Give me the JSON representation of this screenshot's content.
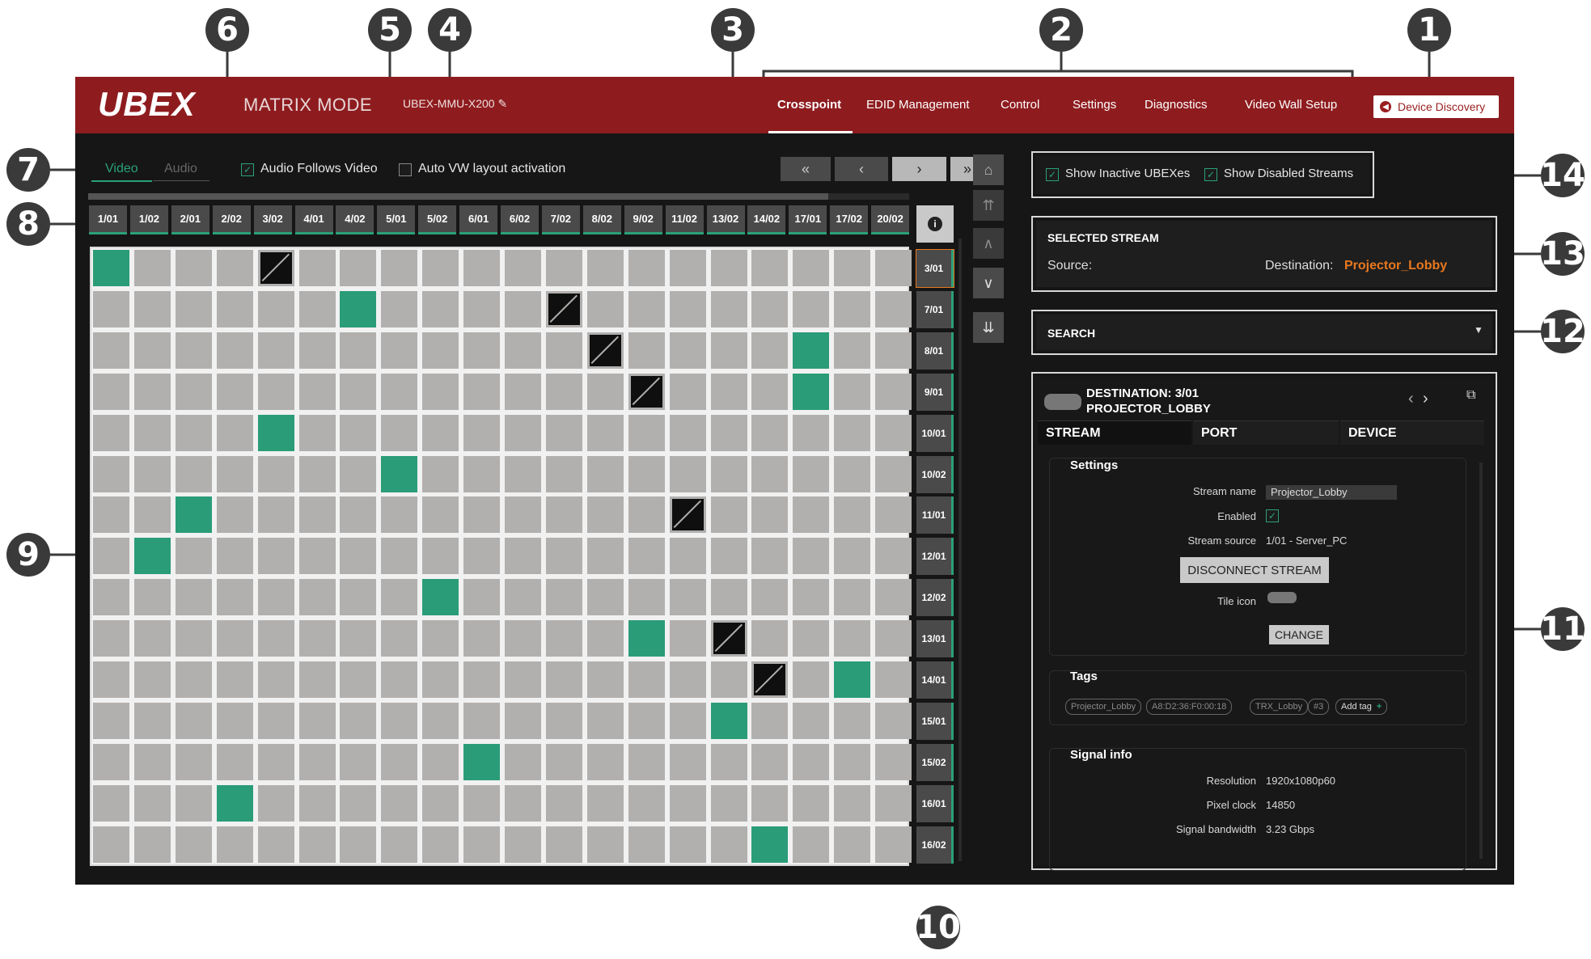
{
  "callouts": [
    "1",
    "2",
    "3",
    "4",
    "5",
    "6",
    "7",
    "8",
    "9",
    "10",
    "11",
    "12",
    "13",
    "14"
  ],
  "header": {
    "logo": "UBEX",
    "mode": "MATRIX MODE",
    "device_name": "UBEX-MMU-X200",
    "nav": [
      "Crosspoint",
      "EDID Management",
      "Control",
      "Settings",
      "Diagnostics",
      "Video Wall Setup"
    ],
    "device_discovery": "Device Discovery"
  },
  "toolbar": {
    "tab_video": "Video",
    "tab_audio": "Audio",
    "audio_follows_video": "Audio Follows Video",
    "auto_vw": "Auto VW layout activation",
    "first": "«",
    "prev": "‹",
    "next": "›",
    "last": "»"
  },
  "matrix": {
    "columns": [
      "1/01",
      "1/02",
      "2/01",
      "2/02",
      "3/02",
      "4/01",
      "4/02",
      "5/01",
      "5/02",
      "6/01",
      "6/02",
      "7/02",
      "8/02",
      "9/02",
      "11/02",
      "13/02",
      "14/02",
      "17/01",
      "17/02",
      "20/02"
    ],
    "rows": [
      "3/01",
      "7/01",
      "8/01",
      "9/01",
      "10/01",
      "10/02",
      "11/01",
      "12/01",
      "12/02",
      "13/01",
      "14/01",
      "15/01",
      "15/02",
      "16/01",
      "16/02"
    ],
    "connected": [
      [
        0,
        0
      ],
      [
        1,
        6
      ],
      [
        2,
        17
      ],
      [
        3,
        17
      ],
      [
        4,
        4
      ],
      [
        5,
        7
      ],
      [
        6,
        2
      ],
      [
        7,
        1
      ],
      [
        8,
        8
      ],
      [
        9,
        13
      ],
      [
        10,
        18
      ],
      [
        11,
        15
      ],
      [
        12,
        9
      ],
      [
        13,
        3
      ],
      [
        14,
        16
      ]
    ],
    "disabled": [
      [
        0,
        4
      ],
      [
        1,
        11
      ],
      [
        2,
        12
      ],
      [
        3,
        13
      ],
      [
        6,
        14
      ],
      [
        9,
        15
      ],
      [
        10,
        16
      ]
    ]
  },
  "options": {
    "show_inactive": "Show Inactive UBEXes",
    "show_disabled": "Show Disabled Streams"
  },
  "selected_stream": {
    "title": "SELECTED STREAM",
    "source_label": "Source:",
    "destination_label": "Destination:",
    "destination_value": "Projector_Lobby"
  },
  "search": {
    "label": "SEARCH"
  },
  "destination": {
    "title_line1": "DESTINATION: 3/01",
    "title_line2": "PROJECTOR_LOBBY",
    "tabs": [
      "STREAM",
      "PORT",
      "DEVICE"
    ],
    "settings_title": "Settings",
    "stream_name_label": "Stream name",
    "stream_name_value": "Projector_Lobby",
    "enabled_label": "Enabled",
    "stream_source_label": "Stream source",
    "stream_source_value": "1/01 - Server_PC",
    "disconnect_button": "DISCONNECT STREAM",
    "tile_icon_label": "Tile icon",
    "change_button": "CHANGE",
    "tags_title": "Tags",
    "tags": [
      "Projector_Lobby",
      "A8:D2:36:F0:00:18",
      "TRX_Lobby",
      "#3"
    ],
    "add_tag": "Add tag",
    "signal_title": "Signal info",
    "resolution_label": "Resolution",
    "resolution_value": "1920x1080p60",
    "pixel_clock_label": "Pixel clock",
    "pixel_clock_value": "14850",
    "bandwidth_label": "Signal bandwidth",
    "bandwidth_value": "3.23 Gbps"
  },
  "colors": {
    "header": "#8e1c1f",
    "accent": "#2aa07a",
    "destination_highlight": "#e8781e"
  }
}
